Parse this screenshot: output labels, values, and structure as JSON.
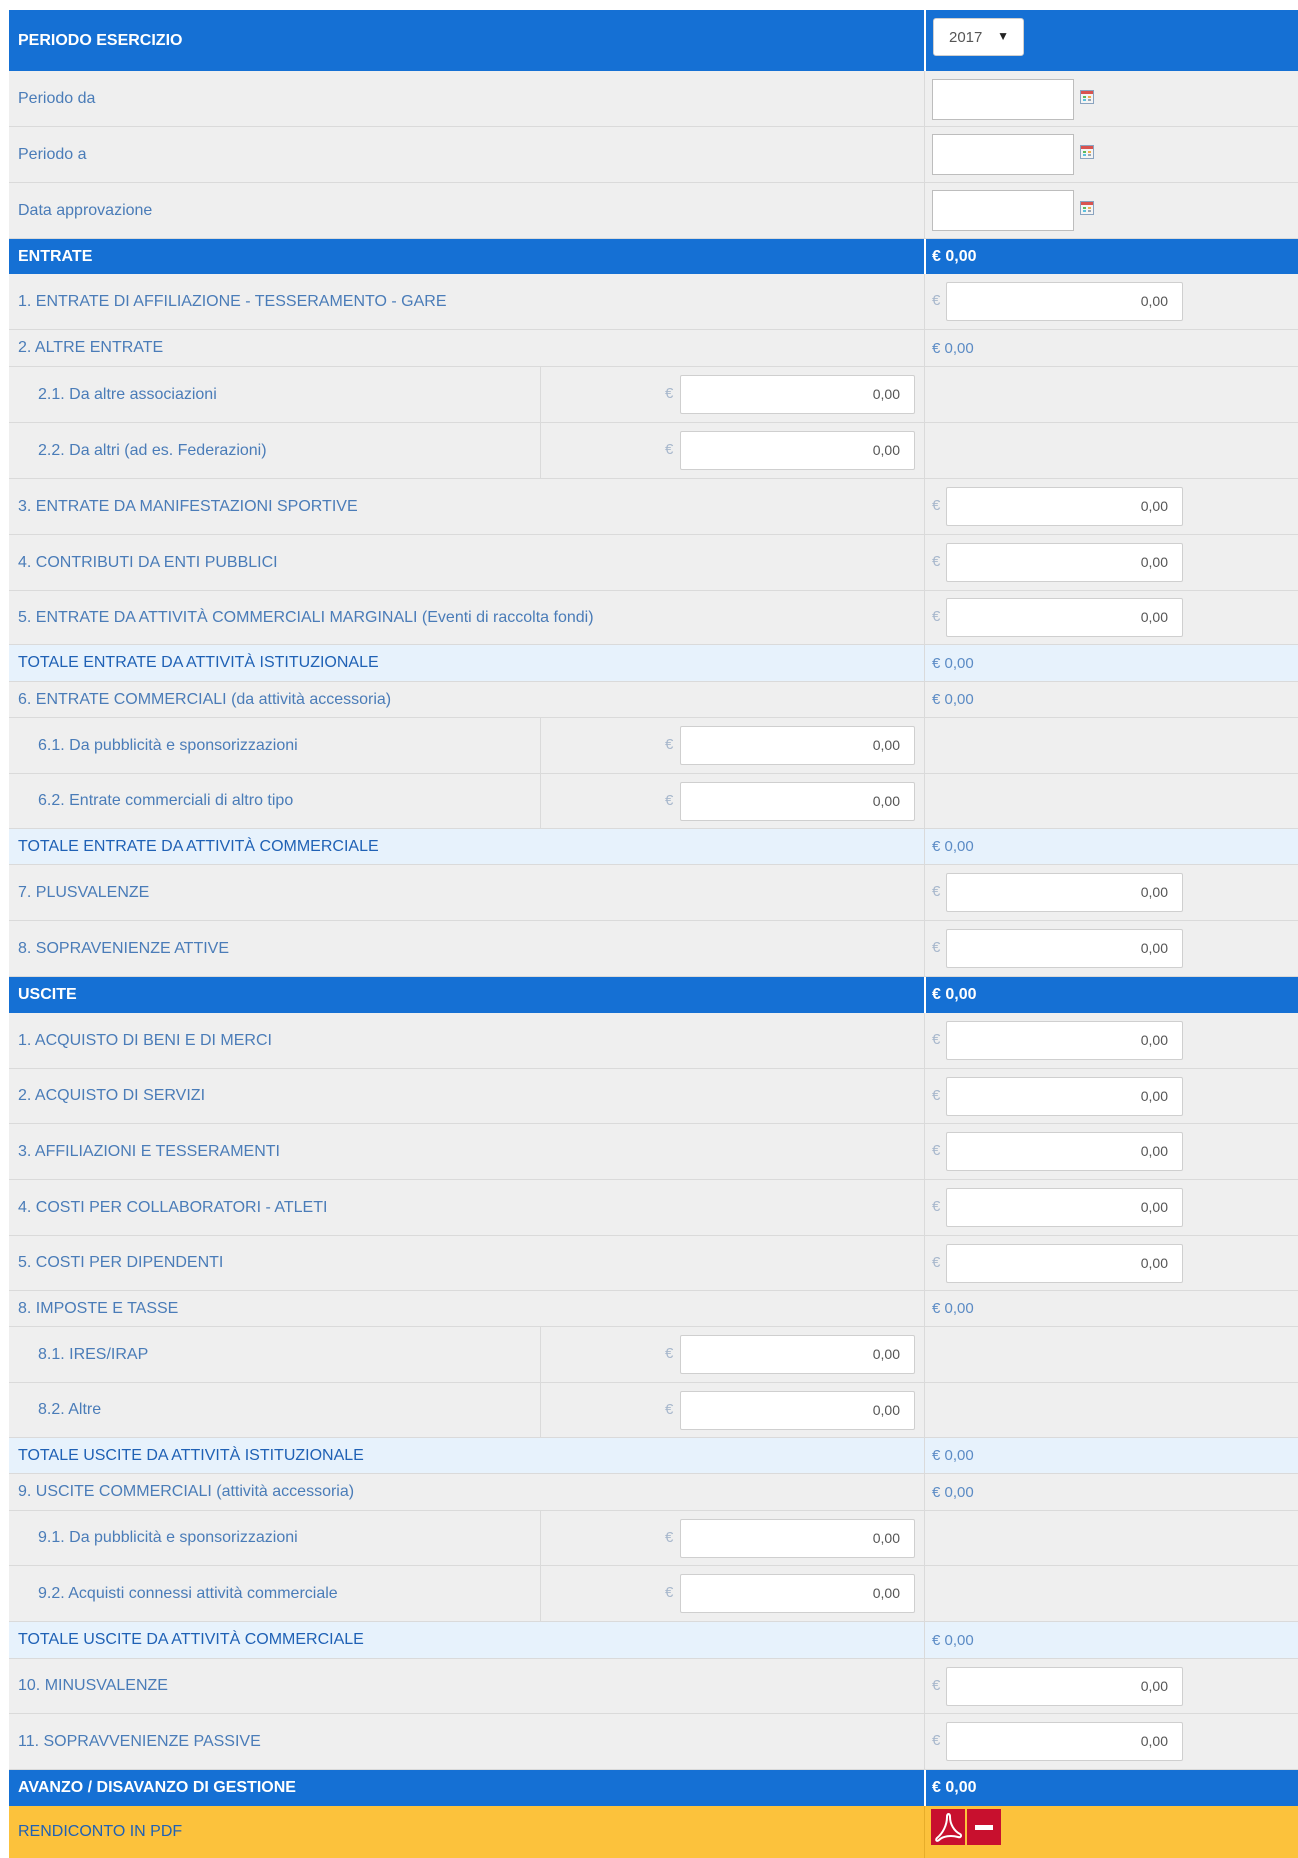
{
  "currency_symbol": "€",
  "periodo": {
    "label": "PERIODO ESERCIZIO",
    "year_value": "2017",
    "fields": [
      {
        "label": "Periodo da",
        "value": ""
      },
      {
        "label": "Periodo a",
        "value": ""
      },
      {
        "label": "Data approvazione",
        "value": ""
      }
    ]
  },
  "entrate": {
    "label": "ENTRATE",
    "total": "€ 0,00",
    "r1": {
      "label": "1. ENTRATE DI AFFILIAZIONE - TESSERAMENTO - GARE",
      "value": "0,00"
    },
    "r2": {
      "label": "2. ALTRE ENTRATE",
      "total": "€ 0,00"
    },
    "r2_1": {
      "label": "2.1. Da altre associazioni",
      "value": "0,00"
    },
    "r2_2": {
      "label": "2.2. Da altri (ad es. Federazioni)",
      "value": "0,00"
    },
    "r3": {
      "label": "3. ENTRATE DA MANIFESTAZIONI SPORTIVE",
      "value": "0,00"
    },
    "r4": {
      "label": "4. CONTRIBUTI DA ENTI PUBBLICI",
      "value": "0,00"
    },
    "r5": {
      "label": "5. ENTRATE DA ATTIVITÀ COMMERCIALI MARGINALI (Eventi di raccolta fondi)",
      "value": "0,00"
    },
    "tot_ist": {
      "label": "TOTALE ENTRATE DA ATTIVITÀ ISTITUZIONALE",
      "total": "€ 0,00"
    },
    "r6": {
      "label": "6. ENTRATE COMMERCIALI (da attività accessoria)",
      "total": "€ 0,00"
    },
    "r6_1": {
      "label": "6.1. Da pubblicità e sponsorizzazioni",
      "value": "0,00"
    },
    "r6_2": {
      "label": "6.2. Entrate commerciali di altro tipo",
      "value": "0,00"
    },
    "tot_comm": {
      "label": "TOTALE ENTRATE DA ATTIVITÀ COMMERCIALE",
      "total": "€ 0,00"
    },
    "r7": {
      "label": "7. PLUSVALENZE",
      "value": "0,00"
    },
    "r8": {
      "label": "8. SOPRAVENIENZE ATTIVE",
      "value": "0,00"
    }
  },
  "uscite": {
    "label": "USCITE",
    "total": "€ 0,00",
    "r1": {
      "label": "1. ACQUISTO DI BENI E DI MERCI",
      "value": "0,00"
    },
    "r2": {
      "label": "2. ACQUISTO DI SERVIZI",
      "value": "0,00"
    },
    "r3": {
      "label": "3. AFFILIAZIONI E TESSERAMENTI",
      "value": "0,00"
    },
    "r4": {
      "label": "4. COSTI PER COLLABORATORI - ATLETI",
      "value": "0,00"
    },
    "r5": {
      "label": "5. COSTI PER DIPENDENTI",
      "value": "0,00"
    },
    "r8": {
      "label": "8. IMPOSTE E TASSE",
      "total": "€ 0,00"
    },
    "r8_1": {
      "label": "8.1. IRES/IRAP",
      "value": "0,00"
    },
    "r8_2": {
      "label": "8.2. Altre",
      "value": "0,00"
    },
    "tot_ist": {
      "label": "TOTALE USCITE DA ATTIVITÀ ISTITUZIONALE",
      "total": "€ 0,00"
    },
    "r9": {
      "label": "9. USCITE COMMERCIALI (attività accessoria)",
      "total": "€ 0,00"
    },
    "r9_1": {
      "label": "9.1. Da pubblicità e sponsorizzazioni",
      "value": "0,00"
    },
    "r9_2": {
      "label": "9.2. Acquisti connessi attività commerciale",
      "value": "0,00"
    },
    "tot_comm": {
      "label": "TOTALE USCITE DA ATTIVITÀ COMMERCIALE",
      "total": "€ 0,00"
    },
    "r10": {
      "label": "10. MINUSVALENZE",
      "value": "0,00"
    },
    "r11": {
      "label": "11. SOPRAVVENIENZE PASSIVE",
      "value": "0,00"
    }
  },
  "avanzo": {
    "label": "AVANZO / DISAVANZO DI GESTIONE",
    "total": "€ 0,00"
  },
  "rendiconto": {
    "label": "RENDICONTO IN PDF"
  },
  "colors": {
    "header_blue": "#1570d4",
    "total_bg": "#e7f2fc",
    "footer_yellow": "#fcc23c",
    "label_blue": "#4a7cb8",
    "pdf_red": "#c8102e"
  }
}
